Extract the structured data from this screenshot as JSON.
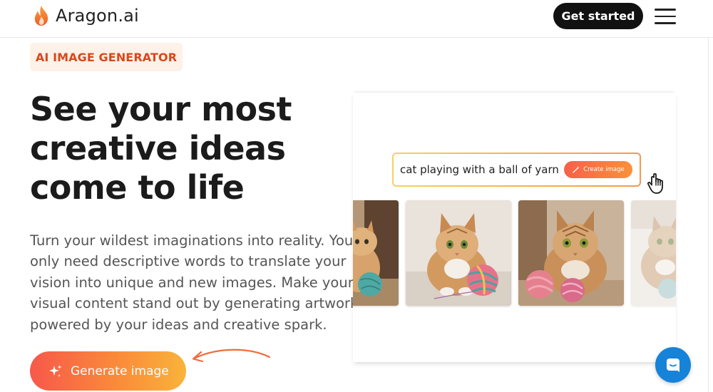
{
  "header": {
    "brand": "Aragon.ai",
    "cta_label": "Get started",
    "icons": {
      "logo": "flame-icon",
      "menu": "hamburger-menu-icon"
    }
  },
  "hero": {
    "badge": "AI IMAGE GENERATOR",
    "headline_lines": [
      "See your most",
      "creative ideas",
      "come to life"
    ],
    "description_lines": [
      "Turn your wildest imaginations into reality. You",
      "only need descriptive words to translate your",
      "vision into unique and new images. Make your",
      "visual content stand out by generating artwork",
      "powered by your ideas and creative spark."
    ],
    "generate_label": "Generate image"
  },
  "demo": {
    "prompt": "cat playing with a ball of yarn",
    "create_label": "Create image",
    "thumbnails": [
      "cat-with-yarn-image-1",
      "cat-with-yarn-image-2",
      "cat-with-yarn-image-3",
      "cat-with-yarn-image-4"
    ]
  },
  "colors": {
    "accent": "#f26b3a",
    "badge_bg": "#fdf1e8",
    "badge_text": "#d9481c",
    "cta_bg": "#111111",
    "chat": "#1683d8"
  }
}
